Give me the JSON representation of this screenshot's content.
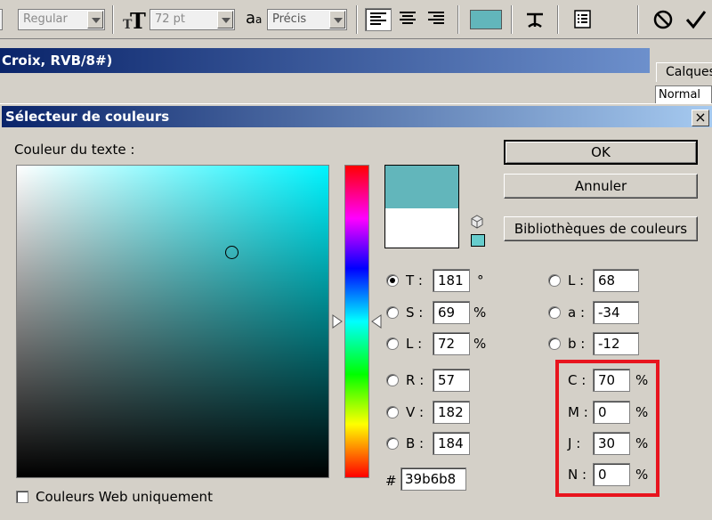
{
  "toolbar": {
    "font_style": "Regular",
    "font_size": "72 pt",
    "antialias_icon_text": "a",
    "antialias_icon_small": "a",
    "antialias": "Précis",
    "text_color": "#62b6bb",
    "icons": [
      "font-style-icon",
      "font-size-icon",
      "antialias-icon",
      "align-left-icon",
      "align-center-icon",
      "align-right-icon",
      "warp-text-icon",
      "character-palette-icon",
      "cancel-icon",
      "commit-icon"
    ]
  },
  "document": {
    "title": "Croix, RVB/8#)"
  },
  "layers": {
    "tab": "Calques",
    "blend_mode": "Normal"
  },
  "dialog": {
    "title": "Sélecteur de couleurs",
    "close": "×",
    "field_label": "Couleur du texte :",
    "buttons": {
      "ok": "OK",
      "cancel": "Annuler",
      "libraries": "Bibliothèques de couleurs"
    },
    "new_color": "#62b6bb",
    "current_color": "#ffffff",
    "websafe_color": "#66cccc",
    "hsb": [
      {
        "label": "T :",
        "value": "181",
        "unit": "°",
        "selected": true
      },
      {
        "label": "S :",
        "value": "69",
        "unit": "%",
        "selected": false
      },
      {
        "label": "L :",
        "value": "72",
        "unit": "%",
        "selected": false
      }
    ],
    "rgb": [
      {
        "label": "R :",
        "value": "57",
        "selected": false
      },
      {
        "label": "V :",
        "value": "182",
        "selected": false
      },
      {
        "label": "B :",
        "value": "184",
        "selected": false
      }
    ],
    "lab": [
      {
        "label": "L :",
        "value": "68",
        "selected": false
      },
      {
        "label": "a :",
        "value": "-34",
        "selected": false
      },
      {
        "label": "b :",
        "value": "-12",
        "selected": false
      }
    ],
    "cmyk": [
      {
        "label": "C :",
        "value": "70",
        "unit": "%"
      },
      {
        "label": "M :",
        "value": "0",
        "unit": "%"
      },
      {
        "label": "J :",
        "value": "30",
        "unit": "%"
      },
      {
        "label": "N :",
        "value": "0",
        "unit": "%"
      }
    ],
    "hex_label": "#",
    "hex": "39b6b8",
    "web_only_label": "Couleurs Web uniquement",
    "highlight_color": "#e8141e"
  }
}
